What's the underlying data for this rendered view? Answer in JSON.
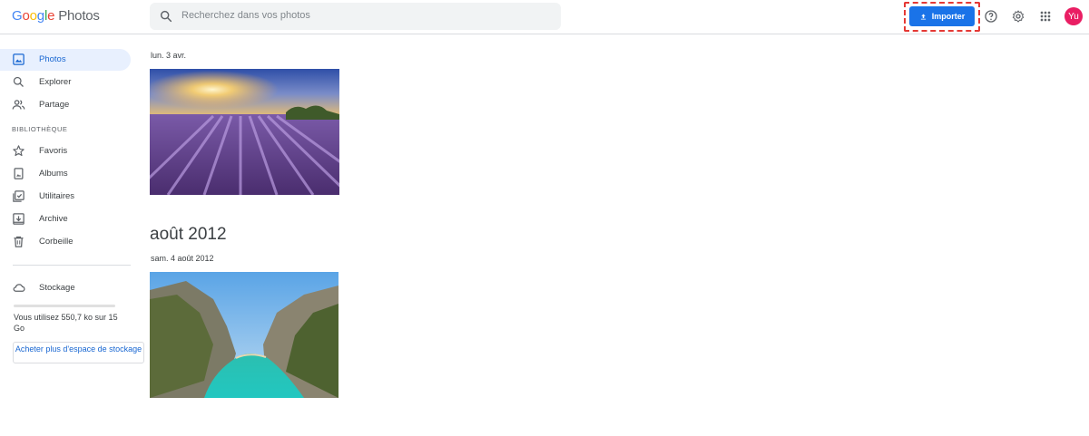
{
  "header": {
    "logo_google": [
      "G",
      "o",
      "o",
      "g",
      "l",
      "e"
    ],
    "logo_product": "Photos",
    "search_placeholder": "Recherchez dans vos photos",
    "import_label": "Importer",
    "avatar_initials": "Yu"
  },
  "sidebar": {
    "items": [
      {
        "label": "Photos",
        "icon": "photo-icon",
        "active": true
      },
      {
        "label": "Explorer",
        "icon": "search-icon"
      },
      {
        "label": "Partage",
        "icon": "people-icon"
      }
    ],
    "section_label": "BIBLIOTHÈQUE",
    "library": [
      {
        "label": "Favoris",
        "icon": "star-icon"
      },
      {
        "label": "Albums",
        "icon": "album-icon"
      },
      {
        "label": "Utilitaires",
        "icon": "utilities-icon"
      },
      {
        "label": "Archive",
        "icon": "archive-icon"
      },
      {
        "label": "Corbeille",
        "icon": "trash-icon"
      }
    ],
    "storage": {
      "label": "Stockage",
      "usage_text": "Vous utilisez 550,7 ko sur 15 Go",
      "used_fraction": 4e-05,
      "buy_label": "Acheter plus d'espace de stockage"
    }
  },
  "main": {
    "groups": [
      {
        "date": "lun. 3 avr.",
        "photo": "lavender-field"
      },
      {
        "month": "août 2012",
        "date": "sam. 4 août 2012",
        "photo": "turquoise-gorge"
      }
    ]
  },
  "colors": {
    "accent": "#1a73e8",
    "active_bg": "#e8f0fe",
    "highlight": "#e53935",
    "avatar": "#e91e63"
  }
}
